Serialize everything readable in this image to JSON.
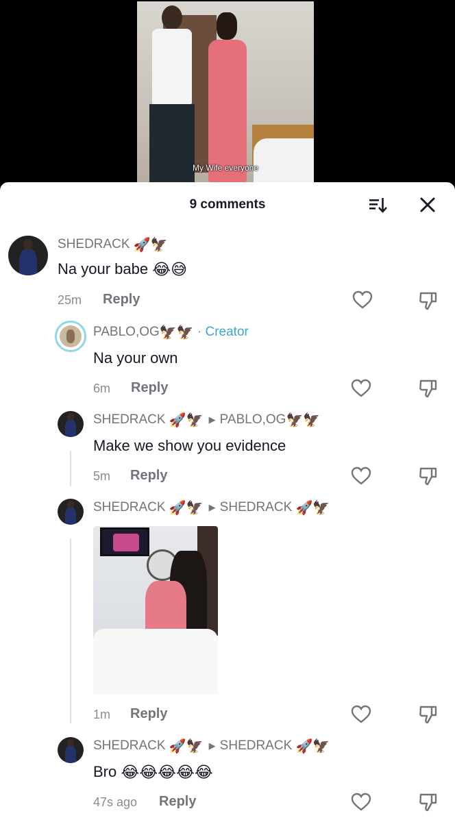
{
  "video": {
    "caption": "My Wife everyone"
  },
  "header": {
    "title": "9 comments"
  },
  "icons": {
    "sort": "sort-icon",
    "close": "close-icon",
    "like": "heart-outline-icon",
    "dislike": "thumb-down-icon",
    "thread_arrow": "right-triangle-icon"
  },
  "colors": {
    "creator": "#3ea6cf",
    "username": "#73747b",
    "text": "#161823",
    "thread_line": "#dedede",
    "avatar_ring": "#8fd8e6"
  },
  "comments": [
    {
      "username": "SHEDRACK",
      "username_emojis": "🚀🦅",
      "text": "Na your babe",
      "text_emojis": "😂😅",
      "time": "25m",
      "reply_label": "Reply"
    },
    {
      "username": "PABLO,OG",
      "username_emojis": "🦅🦅",
      "creator_label": "· Creator",
      "text": "Na your own",
      "time": "6m",
      "reply_label": "Reply"
    },
    {
      "username": "SHEDRACK",
      "username_emojis": "🚀🦅",
      "reply_to": "PABLO,OG",
      "reply_to_emojis": "🦅🦅",
      "text": "Make we show you evidence",
      "time": "5m",
      "reply_label": "Reply"
    },
    {
      "username": "SHEDRACK",
      "username_emojis": "🚀🦅",
      "reply_to": "SHEDRACK",
      "reply_to_emojis": "🚀🦅",
      "has_image": true,
      "time": "1m",
      "reply_label": "Reply"
    },
    {
      "username": "SHEDRACK",
      "username_emojis": "🚀🦅",
      "reply_to": "SHEDRACK",
      "reply_to_emojis": "🚀🦅",
      "text": "Bro",
      "text_emojis": "😂😂😂😂😂",
      "time": "47s ago",
      "reply_label": "Reply"
    }
  ]
}
